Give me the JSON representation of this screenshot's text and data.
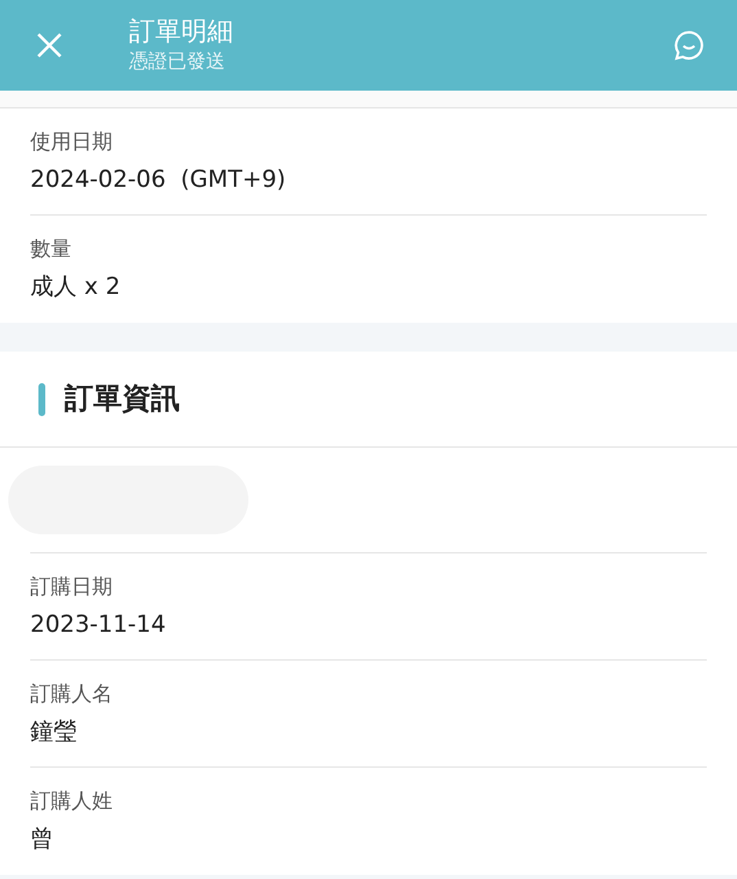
{
  "header": {
    "title": "訂單明細",
    "subtitle": "憑證已發送"
  },
  "booking_details": [
    {
      "label": "使用日期",
      "value": "2024-02-06  (GMT+9)"
    },
    {
      "label": "數量",
      "value": "成人 x 2"
    }
  ],
  "order_info": {
    "heading": "訂單資訊",
    "fields": [
      {
        "label": "訂購日期",
        "value": "2023-11-14"
      },
      {
        "label": "訂購人名",
        "value": "鐘瑩"
      },
      {
        "label": "訂購人姓",
        "value": "曾"
      }
    ]
  }
}
